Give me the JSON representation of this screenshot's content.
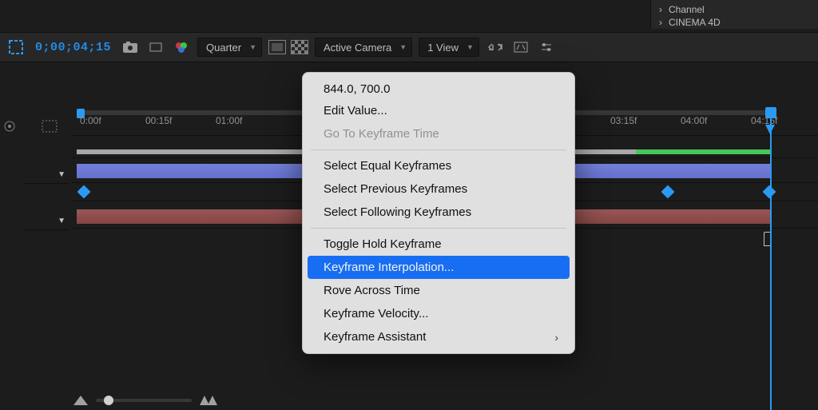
{
  "right_panel": {
    "item1": "Channel",
    "item2": "CINEMA 4D"
  },
  "toolbar": {
    "timecode": "0;00;04;15",
    "resolution": "Quarter",
    "camera": "Active Camera",
    "views": "1 View"
  },
  "ruler": {
    "ticks": [
      "0:00f",
      "00:15f",
      "01:00f",
      "03:15f",
      "04:00f",
      "04:15f"
    ]
  },
  "menu": {
    "coords": "844.0, 700.0",
    "edit_value": "Edit Value...",
    "go_to": "Go To Keyframe Time",
    "select_equal": "Select Equal Keyframes",
    "select_prev": "Select Previous Keyframes",
    "select_follow": "Select Following Keyframes",
    "toggle_hold": "Toggle Hold Keyframe",
    "interpolation": "Keyframe Interpolation...",
    "rove": "Rove Across Time",
    "velocity": "Keyframe Velocity...",
    "assistant": "Keyframe Assistant"
  }
}
